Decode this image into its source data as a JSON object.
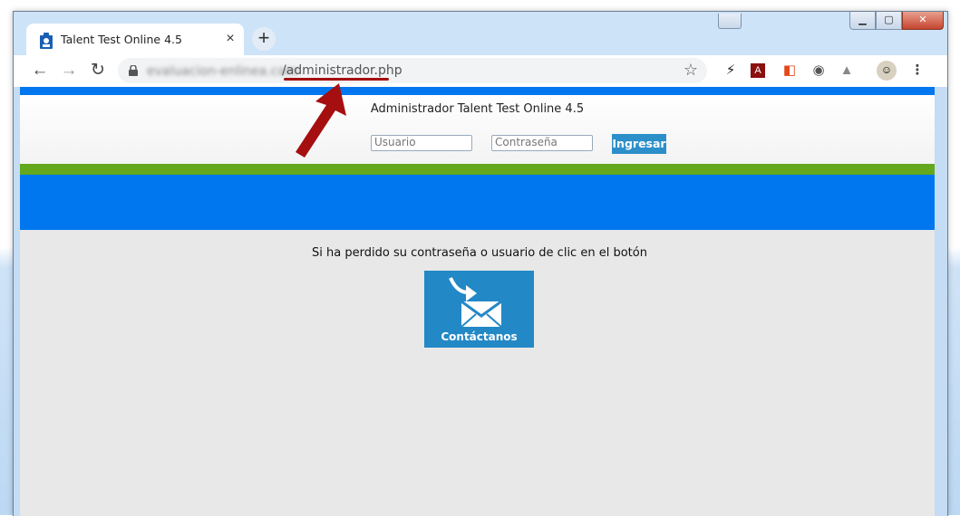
{
  "tab": {
    "title": "Talent Test Online 4.5",
    "close": "×"
  },
  "newtab": "+",
  "window_controls": {
    "minimize": "▁",
    "maximize": "▢",
    "close": "✕"
  },
  "toolbar": {
    "back": "←",
    "forward": "→",
    "reload": "↻",
    "url_host_blurred": "evaluacion-enlinea.com",
    "url_path": "/administrador.php",
    "bookmark_icon": "☆",
    "extensions": [
      "lightning-icon",
      "pdf-icon",
      "office-icon",
      "circle-icon",
      "drive-icon",
      "avatar"
    ]
  },
  "page": {
    "header_title": "Administrador Talent Test Online 4.5",
    "username_placeholder": "Usuario",
    "password_placeholder": "Contraseña",
    "login_button": "Ingresar",
    "recover_text": "Si ha perdido su contraseña o usuario de clic en el botón",
    "contact_button": "Contáctanos"
  },
  "colors": {
    "top_bar": "#0077ef",
    "green_bar": "#63a81d",
    "button": "#2d8fc9",
    "annotation": "#a50f0f"
  }
}
